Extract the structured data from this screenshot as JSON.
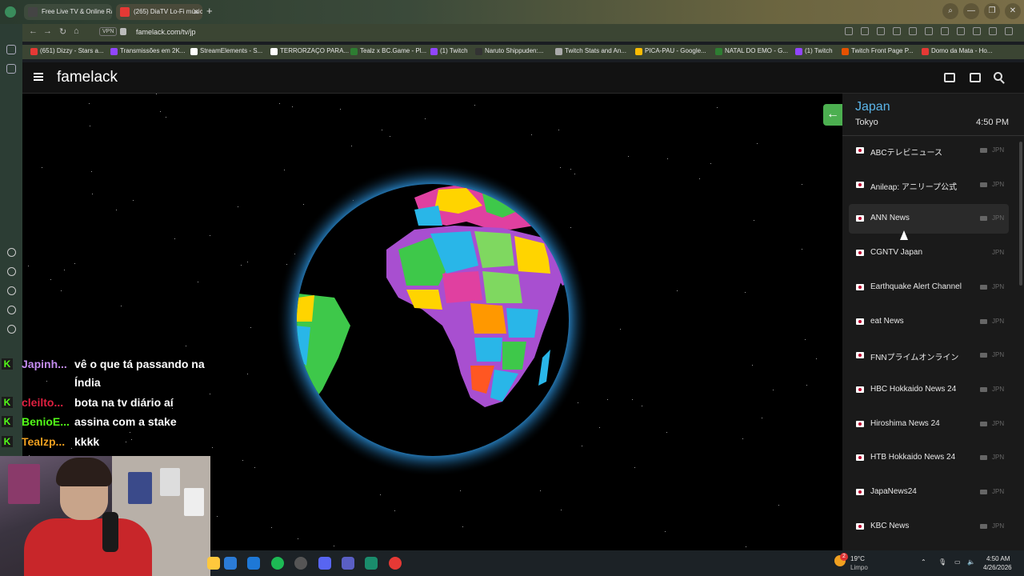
{
  "browser": {
    "tabs": [
      {
        "label": "Free Live TV & Online Ra"
      },
      {
        "label": "(265) DiaTV Lo-Fi músic"
      }
    ],
    "vpn_label": "VPN",
    "url": "famelack.com/tv/jp",
    "bookmarks": [
      {
        "label": "(651) Dizzy - Stars a...",
        "color": "#e53935"
      },
      {
        "label": "Transmissões em 2K...",
        "color": "#9146ff"
      },
      {
        "label": "StreamElements - S...",
        "color": "#ffffff"
      },
      {
        "label": "TERRORZAÇO PARA...",
        "color": "#ffffff"
      },
      {
        "label": "Tealz x BC.Game - Pl...",
        "color": "#2e7d32"
      },
      {
        "label": "(1) Twitch",
        "color": "#9146ff"
      },
      {
        "label": "Naruto Shippuden:...",
        "color": "#333333"
      },
      {
        "label": "Twitch Stats and An...",
        "color": "#aaaaaa"
      },
      {
        "label": "PICA-PAU - Google...",
        "color": "#fbbc04"
      },
      {
        "label": "NATAL DO EMO - G...",
        "color": "#2e7d32"
      },
      {
        "label": "(1) Twitch",
        "color": "#9146ff"
      },
      {
        "label": "Twitch Front Page P...",
        "color": "#e65100"
      },
      {
        "label": "Domo da Mata - Ho...",
        "color": "#e53935"
      }
    ]
  },
  "app": {
    "brand": "famelack",
    "header_icons": [
      "monitor-icon",
      "pip-icon",
      "search-icon"
    ]
  },
  "sidebar": {
    "country": "Japan",
    "city": "Tokyo",
    "time": "4:50 PM",
    "accent": "#5ab4e8",
    "channels": [
      {
        "name": "ABCテレビニュース",
        "code": "JPN",
        "cam": true
      },
      {
        "name": "Anileap: アニリープ公式",
        "code": "JPN",
        "cam": true
      },
      {
        "name": "ANN News",
        "code": "JPN",
        "cam": true
      },
      {
        "name": "CGNTV Japan",
        "code": "JPN",
        "cam": false
      },
      {
        "name": "Earthquake Alert Channel",
        "code": "JPN",
        "cam": true
      },
      {
        "name": "eat News",
        "code": "JPN",
        "cam": true
      },
      {
        "name": "FNNプライムオンライン",
        "code": "JPN",
        "cam": true
      },
      {
        "name": "HBC Hokkaido News 24",
        "code": "JPN",
        "cam": true
      },
      {
        "name": "Hiroshima News 24",
        "code": "JPN",
        "cam": true
      },
      {
        "name": "HTB Hokkaido News 24",
        "code": "JPN",
        "cam": true
      },
      {
        "name": "JapaNews24",
        "code": "JPN",
        "cam": true
      },
      {
        "name": "KBC News",
        "code": "JPN",
        "cam": true
      }
    ]
  },
  "chat": [
    {
      "user": "Japinh...",
      "color": "#c48cf0",
      "message": "vê o que tá passando na Índia"
    },
    {
      "user": "cleilto...",
      "color": "#e02040",
      "message": "bota na tv diário aí"
    },
    {
      "user": "BenioE...",
      "color": "#53fc18",
      "message": "assina com a stake"
    },
    {
      "user": "Tealzp...",
      "color": "#f0a020",
      "message": "kkkk"
    }
  ],
  "taskbar": {
    "temperature": "19°C",
    "weather": "Limpo",
    "badge": "2",
    "clock_time": "4:50 AM",
    "clock_date": "4/26/2026"
  }
}
